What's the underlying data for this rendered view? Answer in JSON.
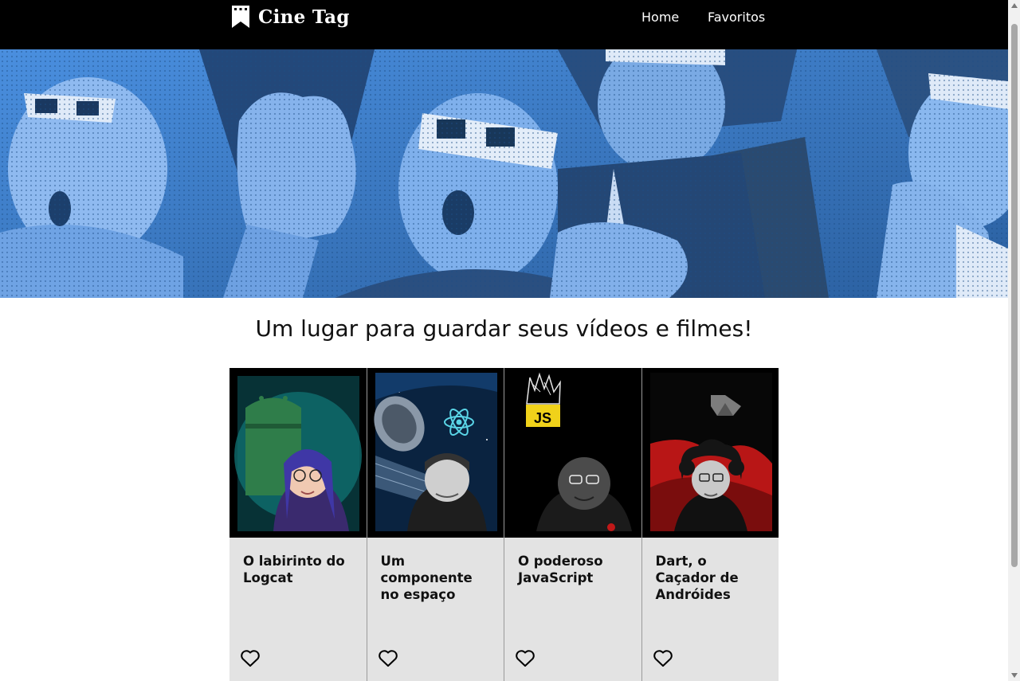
{
  "header": {
    "logo_text": "Cine Tag",
    "nav": [
      {
        "label": "Home"
      },
      {
        "label": "Favoritos"
      }
    ]
  },
  "banner": {
    "image": "audience-3d-glasses-photo"
  },
  "main": {
    "title": "Um lugar para guardar seus vídeos e filmes!"
  },
  "cards": [
    {
      "title": "O labirinto do Logcat",
      "thumbnail": "android-mascot-presenter",
      "favorite_icon": "heart-outline-icon"
    },
    {
      "title": "Um componente no espaço",
      "thumbnail": "satellite-react-presenter",
      "favorite_icon": "heart-outline-icon"
    },
    {
      "title": "O poderoso JavaScript",
      "thumbnail": "js-logo-presenter",
      "favorite_icon": "heart-outline-icon"
    },
    {
      "title": "Dart, o Caçador de Andróides",
      "thumbnail": "dart-logo-presenter",
      "favorite_icon": "heart-outline-icon"
    }
  ],
  "colors": {
    "header_bg": "#000000",
    "banner_blue": "#3a7fd0",
    "card_bg": "#e3e3e3",
    "text": "#111111"
  }
}
